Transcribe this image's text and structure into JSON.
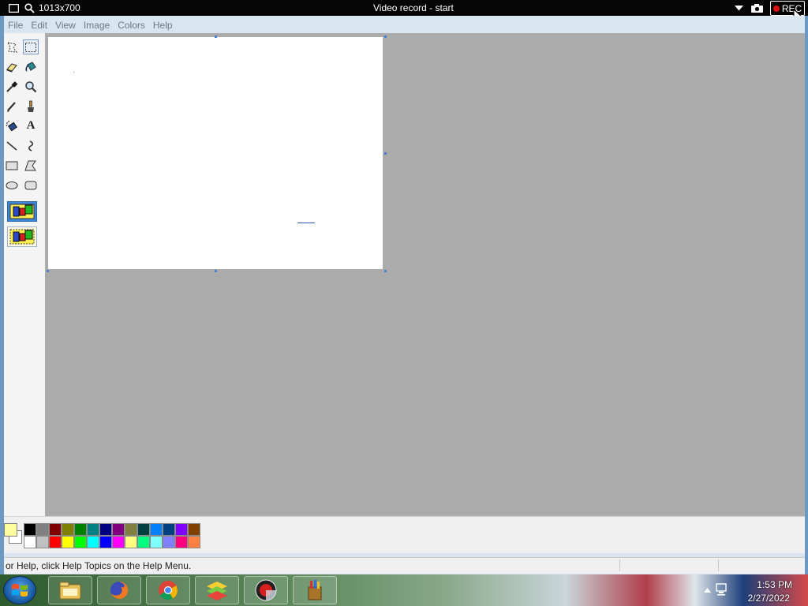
{
  "top_bar": {
    "resolution": "1013x700",
    "title": "Video record - start",
    "rec_label": "REC"
  },
  "menu": [
    "File",
    "Edit",
    "View",
    "Image",
    "Colors",
    "Help"
  ],
  "tools": [
    {
      "name": "free-form-select-icon",
      "selected": false
    },
    {
      "name": "select-icon",
      "selected": true
    },
    {
      "name": "eraser-icon",
      "selected": false
    },
    {
      "name": "fill-bucket-icon",
      "selected": false
    },
    {
      "name": "color-picker-icon",
      "selected": false
    },
    {
      "name": "magnifier-icon",
      "selected": false
    },
    {
      "name": "pencil-icon",
      "selected": false
    },
    {
      "name": "brush-icon",
      "selected": false
    },
    {
      "name": "airbrush-icon",
      "selected": false
    },
    {
      "name": "text-icon",
      "selected": false
    },
    {
      "name": "line-icon",
      "selected": false
    },
    {
      "name": "curve-icon",
      "selected": false
    },
    {
      "name": "rectangle-icon",
      "selected": false
    },
    {
      "name": "polygon-icon",
      "selected": false
    },
    {
      "name": "ellipse-icon",
      "selected": false
    },
    {
      "name": "rounded-rectangle-icon",
      "selected": false
    }
  ],
  "text_tool_glyph": "A",
  "selection_options": [
    {
      "name": "opaque-selection-icon",
      "selected": true
    },
    {
      "name": "transparent-selection-icon",
      "selected": false
    }
  ],
  "colors": {
    "foreground": "#ffffa0",
    "background": "#ffffff",
    "palette_row1": [
      "#000000",
      "#808080",
      "#800000",
      "#808000",
      "#008000",
      "#008080",
      "#000080",
      "#800080",
      "#808040",
      "#004040",
      "#0080ff",
      "#004080",
      "#8000ff",
      "#804000"
    ],
    "palette_row2": [
      "#ffffff",
      "#c0c0c0",
      "#ff0000",
      "#ffff00",
      "#00ff00",
      "#00ffff",
      "#0000ff",
      "#ff00ff",
      "#ffff80",
      "#00ff80",
      "#80ffff",
      "#8080ff",
      "#ff0080",
      "#ff8040"
    ]
  },
  "status_bar": {
    "text": "or Help, click Help Topics on the Help Menu."
  },
  "taskbar": {
    "apps": [
      {
        "name": "file-explorer-icon"
      },
      {
        "name": "firefox-icon"
      },
      {
        "name": "chrome-icon"
      },
      {
        "name": "bluestacks-icon"
      },
      {
        "name": "screen-recorder-icon"
      },
      {
        "name": "paint-icon"
      }
    ],
    "time": "1:53 PM",
    "date": "2/27/2022"
  }
}
